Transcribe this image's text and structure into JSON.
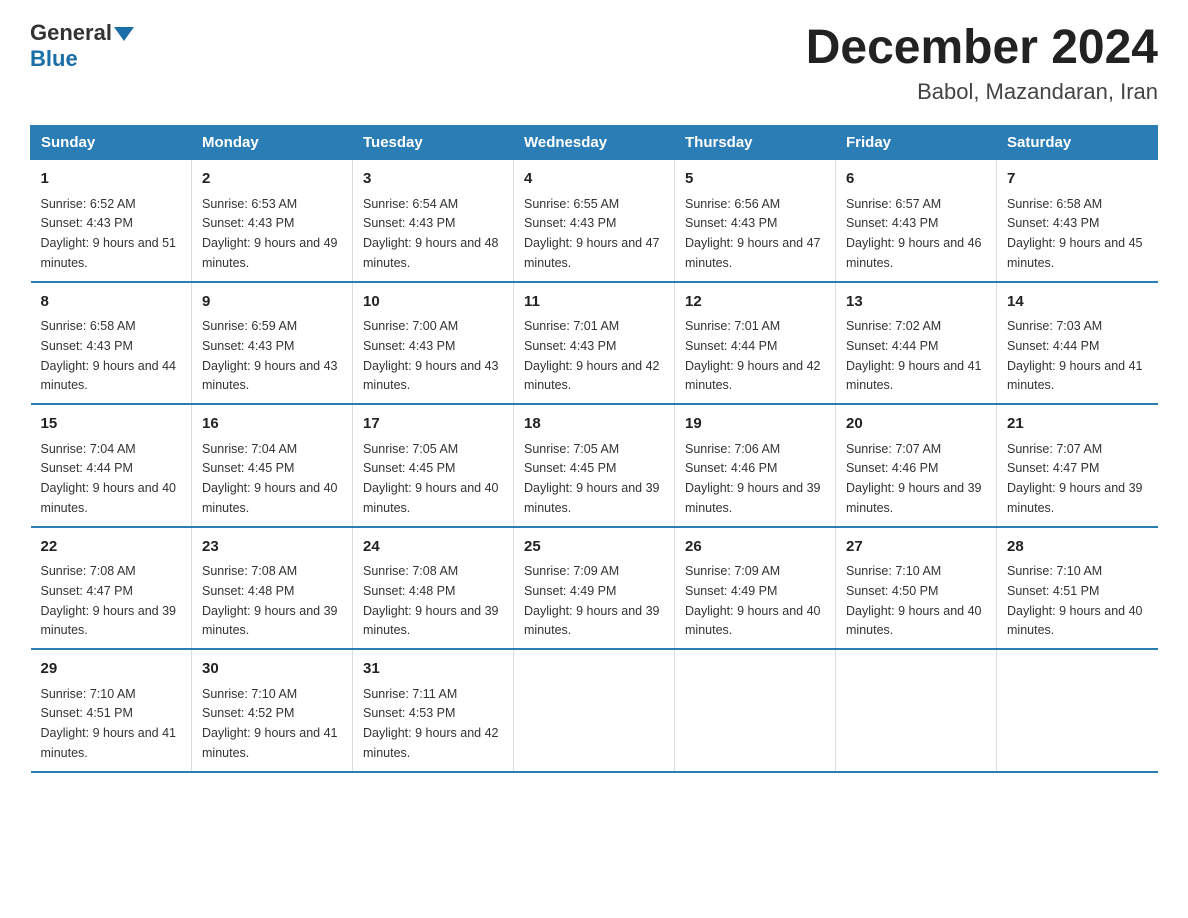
{
  "header": {
    "logo_general": "General",
    "logo_blue": "Blue",
    "title": "December 2024",
    "subtitle": "Babol, Mazandaran, Iran"
  },
  "days_of_week": [
    "Sunday",
    "Monday",
    "Tuesday",
    "Wednesday",
    "Thursday",
    "Friday",
    "Saturday"
  ],
  "weeks": [
    [
      {
        "day": "1",
        "sunrise": "Sunrise: 6:52 AM",
        "sunset": "Sunset: 4:43 PM",
        "daylight": "Daylight: 9 hours and 51 minutes."
      },
      {
        "day": "2",
        "sunrise": "Sunrise: 6:53 AM",
        "sunset": "Sunset: 4:43 PM",
        "daylight": "Daylight: 9 hours and 49 minutes."
      },
      {
        "day": "3",
        "sunrise": "Sunrise: 6:54 AM",
        "sunset": "Sunset: 4:43 PM",
        "daylight": "Daylight: 9 hours and 48 minutes."
      },
      {
        "day": "4",
        "sunrise": "Sunrise: 6:55 AM",
        "sunset": "Sunset: 4:43 PM",
        "daylight": "Daylight: 9 hours and 47 minutes."
      },
      {
        "day": "5",
        "sunrise": "Sunrise: 6:56 AM",
        "sunset": "Sunset: 4:43 PM",
        "daylight": "Daylight: 9 hours and 47 minutes."
      },
      {
        "day": "6",
        "sunrise": "Sunrise: 6:57 AM",
        "sunset": "Sunset: 4:43 PM",
        "daylight": "Daylight: 9 hours and 46 minutes."
      },
      {
        "day": "7",
        "sunrise": "Sunrise: 6:58 AM",
        "sunset": "Sunset: 4:43 PM",
        "daylight": "Daylight: 9 hours and 45 minutes."
      }
    ],
    [
      {
        "day": "8",
        "sunrise": "Sunrise: 6:58 AM",
        "sunset": "Sunset: 4:43 PM",
        "daylight": "Daylight: 9 hours and 44 minutes."
      },
      {
        "day": "9",
        "sunrise": "Sunrise: 6:59 AM",
        "sunset": "Sunset: 4:43 PM",
        "daylight": "Daylight: 9 hours and 43 minutes."
      },
      {
        "day": "10",
        "sunrise": "Sunrise: 7:00 AM",
        "sunset": "Sunset: 4:43 PM",
        "daylight": "Daylight: 9 hours and 43 minutes."
      },
      {
        "day": "11",
        "sunrise": "Sunrise: 7:01 AM",
        "sunset": "Sunset: 4:43 PM",
        "daylight": "Daylight: 9 hours and 42 minutes."
      },
      {
        "day": "12",
        "sunrise": "Sunrise: 7:01 AM",
        "sunset": "Sunset: 4:44 PM",
        "daylight": "Daylight: 9 hours and 42 minutes."
      },
      {
        "day": "13",
        "sunrise": "Sunrise: 7:02 AM",
        "sunset": "Sunset: 4:44 PM",
        "daylight": "Daylight: 9 hours and 41 minutes."
      },
      {
        "day": "14",
        "sunrise": "Sunrise: 7:03 AM",
        "sunset": "Sunset: 4:44 PM",
        "daylight": "Daylight: 9 hours and 41 minutes."
      }
    ],
    [
      {
        "day": "15",
        "sunrise": "Sunrise: 7:04 AM",
        "sunset": "Sunset: 4:44 PM",
        "daylight": "Daylight: 9 hours and 40 minutes."
      },
      {
        "day": "16",
        "sunrise": "Sunrise: 7:04 AM",
        "sunset": "Sunset: 4:45 PM",
        "daylight": "Daylight: 9 hours and 40 minutes."
      },
      {
        "day": "17",
        "sunrise": "Sunrise: 7:05 AM",
        "sunset": "Sunset: 4:45 PM",
        "daylight": "Daylight: 9 hours and 40 minutes."
      },
      {
        "day": "18",
        "sunrise": "Sunrise: 7:05 AM",
        "sunset": "Sunset: 4:45 PM",
        "daylight": "Daylight: 9 hours and 39 minutes."
      },
      {
        "day": "19",
        "sunrise": "Sunrise: 7:06 AM",
        "sunset": "Sunset: 4:46 PM",
        "daylight": "Daylight: 9 hours and 39 minutes."
      },
      {
        "day": "20",
        "sunrise": "Sunrise: 7:07 AM",
        "sunset": "Sunset: 4:46 PM",
        "daylight": "Daylight: 9 hours and 39 minutes."
      },
      {
        "day": "21",
        "sunrise": "Sunrise: 7:07 AM",
        "sunset": "Sunset: 4:47 PM",
        "daylight": "Daylight: 9 hours and 39 minutes."
      }
    ],
    [
      {
        "day": "22",
        "sunrise": "Sunrise: 7:08 AM",
        "sunset": "Sunset: 4:47 PM",
        "daylight": "Daylight: 9 hours and 39 minutes."
      },
      {
        "day": "23",
        "sunrise": "Sunrise: 7:08 AM",
        "sunset": "Sunset: 4:48 PM",
        "daylight": "Daylight: 9 hours and 39 minutes."
      },
      {
        "day": "24",
        "sunrise": "Sunrise: 7:08 AM",
        "sunset": "Sunset: 4:48 PM",
        "daylight": "Daylight: 9 hours and 39 minutes."
      },
      {
        "day": "25",
        "sunrise": "Sunrise: 7:09 AM",
        "sunset": "Sunset: 4:49 PM",
        "daylight": "Daylight: 9 hours and 39 minutes."
      },
      {
        "day": "26",
        "sunrise": "Sunrise: 7:09 AM",
        "sunset": "Sunset: 4:49 PM",
        "daylight": "Daylight: 9 hours and 40 minutes."
      },
      {
        "day": "27",
        "sunrise": "Sunrise: 7:10 AM",
        "sunset": "Sunset: 4:50 PM",
        "daylight": "Daylight: 9 hours and 40 minutes."
      },
      {
        "day": "28",
        "sunrise": "Sunrise: 7:10 AM",
        "sunset": "Sunset: 4:51 PM",
        "daylight": "Daylight: 9 hours and 40 minutes."
      }
    ],
    [
      {
        "day": "29",
        "sunrise": "Sunrise: 7:10 AM",
        "sunset": "Sunset: 4:51 PM",
        "daylight": "Daylight: 9 hours and 41 minutes."
      },
      {
        "day": "30",
        "sunrise": "Sunrise: 7:10 AM",
        "sunset": "Sunset: 4:52 PM",
        "daylight": "Daylight: 9 hours and 41 minutes."
      },
      {
        "day": "31",
        "sunrise": "Sunrise: 7:11 AM",
        "sunset": "Sunset: 4:53 PM",
        "daylight": "Daylight: 9 hours and 42 minutes."
      },
      {
        "day": "",
        "sunrise": "",
        "sunset": "",
        "daylight": ""
      },
      {
        "day": "",
        "sunrise": "",
        "sunset": "",
        "daylight": ""
      },
      {
        "day": "",
        "sunrise": "",
        "sunset": "",
        "daylight": ""
      },
      {
        "day": "",
        "sunrise": "",
        "sunset": "",
        "daylight": ""
      }
    ]
  ]
}
